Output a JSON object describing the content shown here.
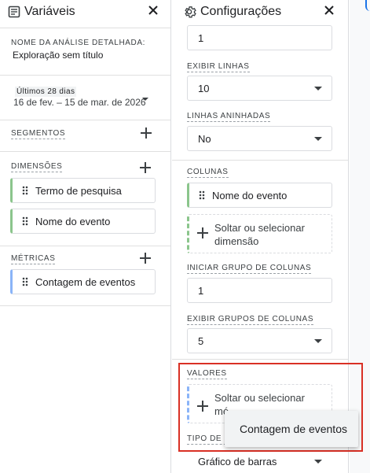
{
  "variables_panel": {
    "title": "Variáveis",
    "analysis_name_label": "NOME DA ANÁLISE DETALHADA:",
    "analysis_name_value": "Exploração sem título",
    "date_range_label": "Últimos 28 dias",
    "date_range_value": "16 de fev. – 15 de mar. de 2026",
    "segments_label": "SEGMENTOS",
    "dimensions_label": "DIMENSÕES",
    "dimensions": [
      "Termo de pesquisa",
      "Nome do evento"
    ],
    "metrics_label": "MÉTRICAS",
    "metrics": [
      "Contagem de eventos"
    ]
  },
  "settings_panel": {
    "title": "Configurações",
    "top_value": "1",
    "show_rows_label": "EXIBIR LINHAS",
    "show_rows_value": "10",
    "nested_rows_label": "LINHAS ANINHADAS",
    "nested_rows_value": "No",
    "columns_label": "COLUNAS",
    "columns_item": "Nome do evento",
    "columns_drop_line1": "Soltar ou selecionar",
    "columns_drop_line2": "dimensão",
    "start_col_group_label": "INICIAR GRUPO DE COLUNAS",
    "start_col_group_value": "1",
    "show_col_groups_label": "EXIBIR GRUPOS DE COLUNAS",
    "show_col_groups_value": "5",
    "values_label": "VALORES",
    "values_drop_line1": "Soltar ou selecionar",
    "values_drop_line2": "mé",
    "chart_type_label": "TIPO DE C",
    "chart_type_value": "Gráfico de barras"
  },
  "popup": {
    "item": "Contagem de eventos"
  },
  "colors": {
    "accent_green": "#8bc58c",
    "accent_blue": "#8ab4f8",
    "highlight_red": "#d93025"
  }
}
